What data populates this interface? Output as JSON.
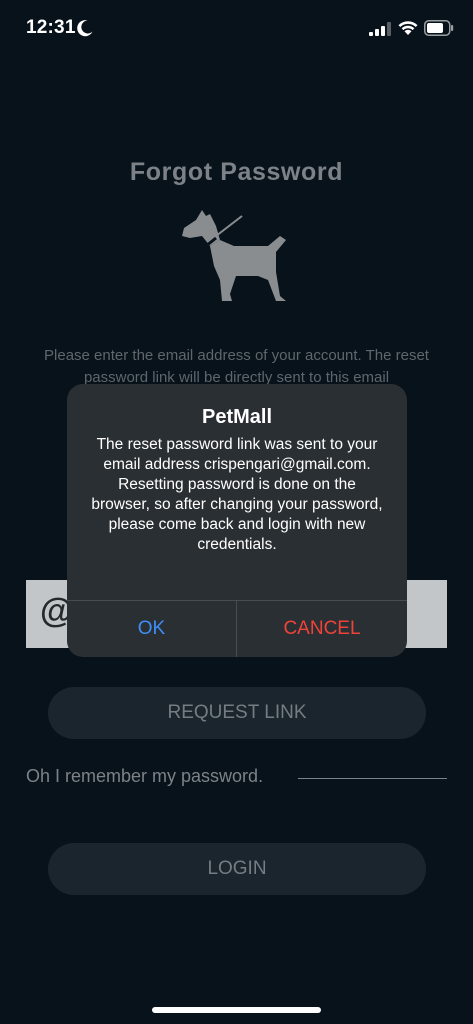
{
  "status_bar": {
    "time": "12:31",
    "icons": [
      "moon-icon",
      "signal-icon",
      "wifi-icon",
      "battery-icon"
    ]
  },
  "page": {
    "title": "Forgot Password",
    "logo_icon": "dog-icon",
    "description": "Please enter the email address of your account. The reset password link will be directly sent to this email",
    "email_field_icon": "@",
    "request_button_label": "REQUEST LINK",
    "remember_label": "Oh I remember my password.",
    "login_button_label": "LOGIN"
  },
  "alert": {
    "title": "PetMall",
    "message": "The reset password link was sent to your email address crispengari@gmail.com. Resetting password is done on the browser, so after changing your password, please come back and login with new credentials.",
    "ok_label": "OK",
    "cancel_label": "CANCEL"
  },
  "colors": {
    "background": "#07121a",
    "alert_background": "#2a2f33",
    "ok": "#3e8ef7",
    "cancel": "#ef4339"
  }
}
